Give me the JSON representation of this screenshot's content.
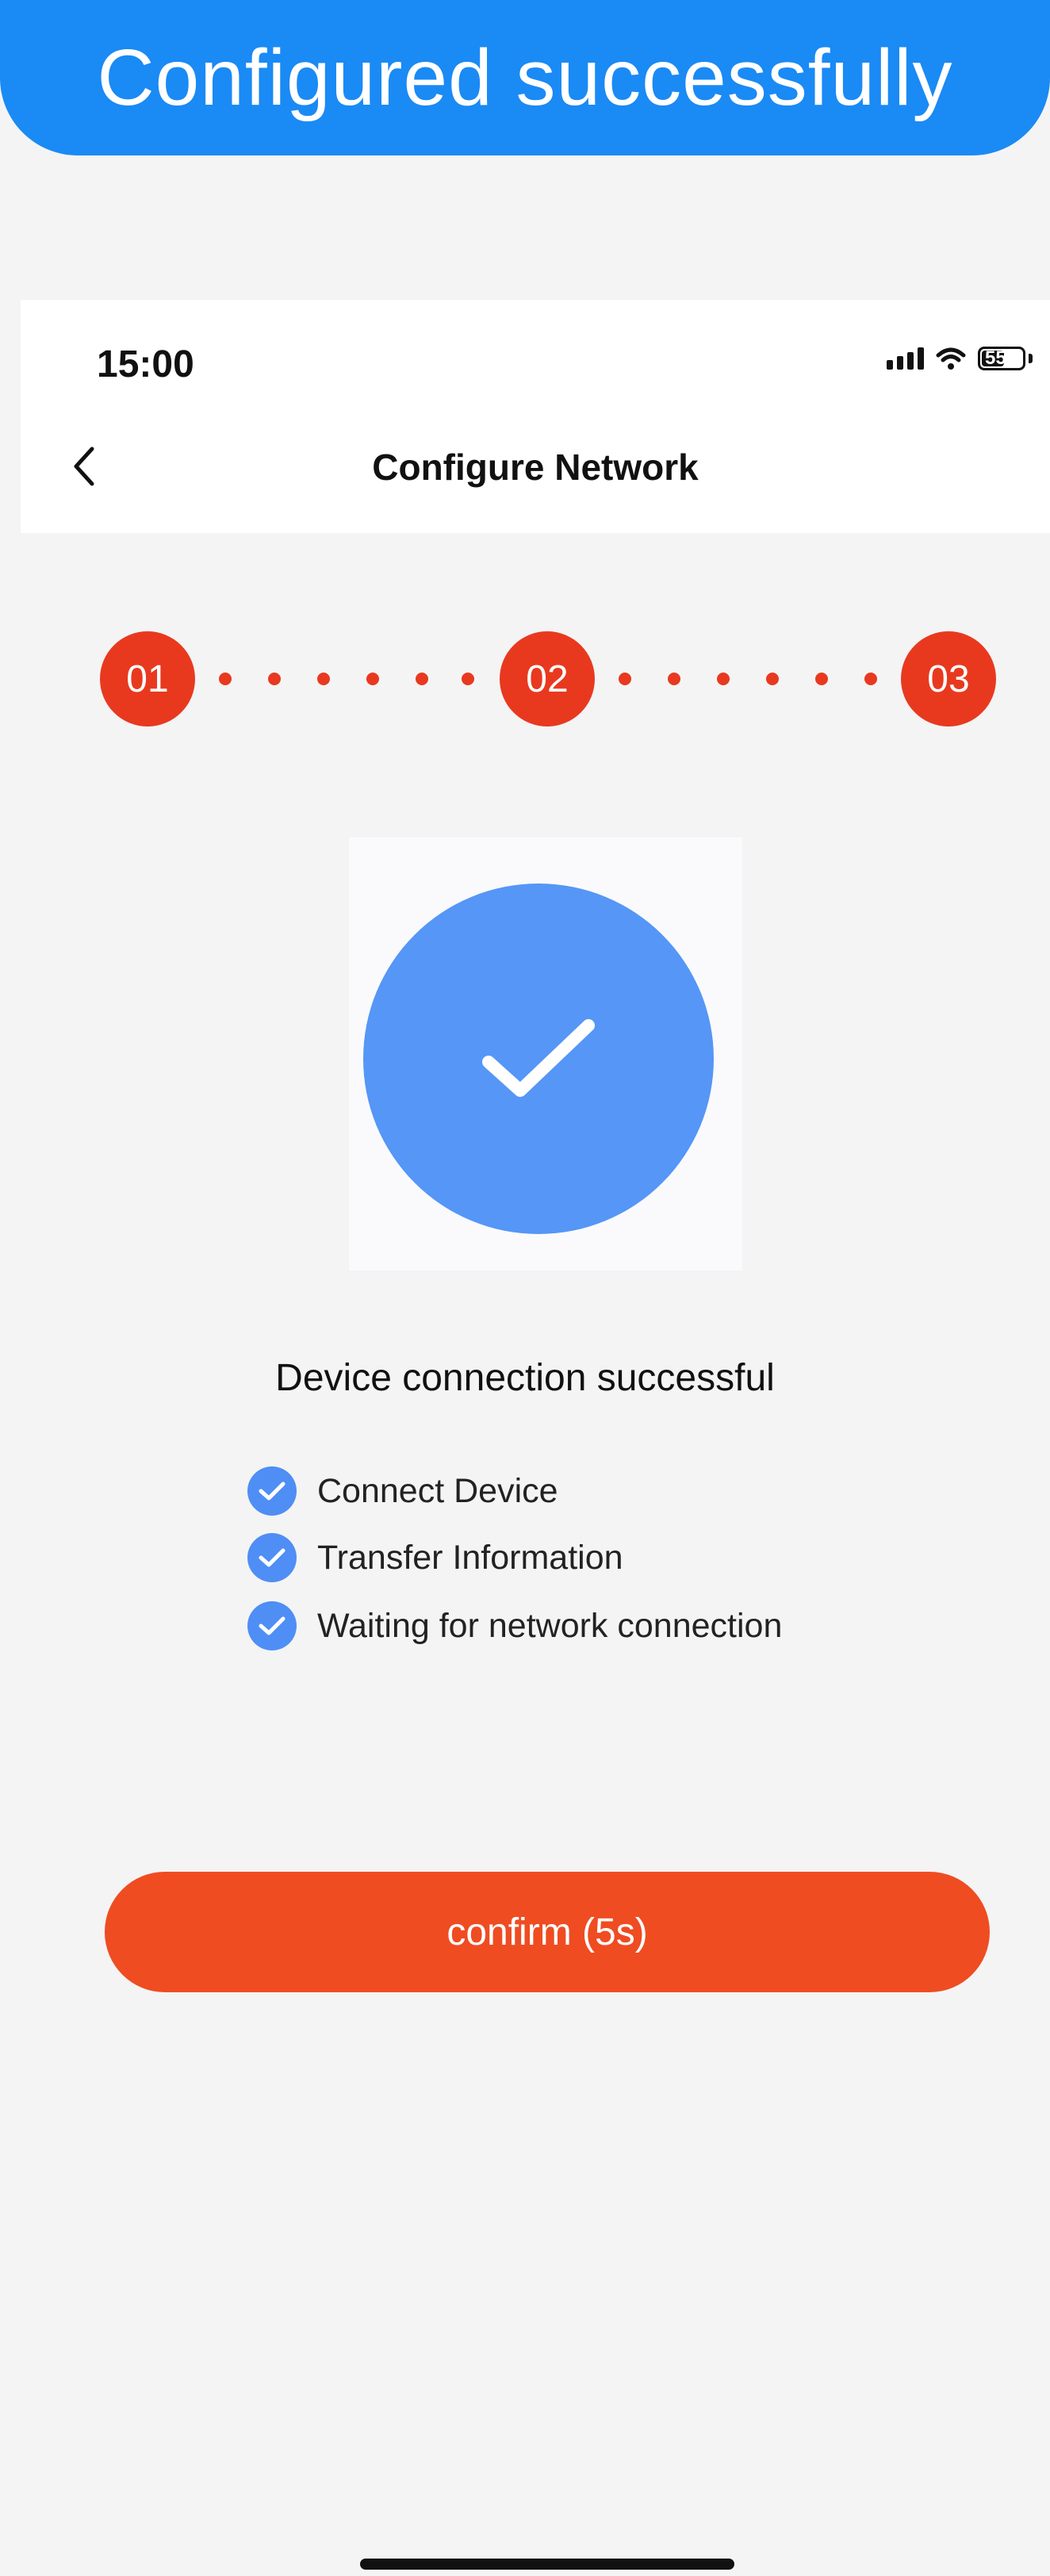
{
  "banner": {
    "text": "Configured successfully"
  },
  "status_bar": {
    "time": "15:00",
    "battery_level": "55",
    "battery_display": "55",
    "icons": [
      "cellular-signal-icon",
      "wifi-icon",
      "battery-icon"
    ]
  },
  "nav": {
    "back_icon": "chevron-left-icon",
    "title": "Configure Network"
  },
  "steps": [
    {
      "label": "01",
      "status": "complete"
    },
    {
      "label": "02",
      "status": "complete"
    },
    {
      "label": "03",
      "status": "complete"
    }
  ],
  "result": {
    "icon": "check-icon",
    "title": "Device connection successful"
  },
  "checklist": [
    {
      "label": "Connect Device",
      "checked": true
    },
    {
      "label": "Transfer Information",
      "checked": true
    },
    {
      "label": "Waiting for network connection",
      "checked": true
    }
  ],
  "confirm_button": {
    "label": "confirm (5s)"
  },
  "colors": {
    "banner": "#1a8af5",
    "step_accent": "#e8391f",
    "success_circle": "#5596f7",
    "check_badge": "#4f8ef5",
    "confirm_button": "#ef4c22",
    "background": "#f4f4f4"
  }
}
